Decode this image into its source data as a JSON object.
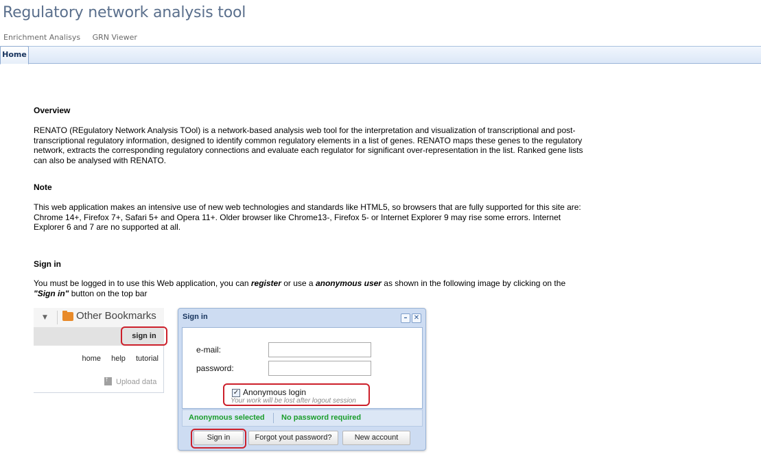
{
  "app": {
    "title": "Regulatory network analysis tool"
  },
  "nav": {
    "links": [
      "Enrichment Analisys",
      "GRN Viewer"
    ]
  },
  "tabs": {
    "home": "Home"
  },
  "overview": {
    "heading": "Overview",
    "text": "RENATO (REgulatory Network Analysis TOol) is a network-based analysis web tool for the interpretation and visualization of transcriptional and post-transcriptional regulatory information, designed to identify common regulatory elements in a list of genes. RENATO maps these genes to the regulatory network, extracts the corresponding regulatory connections and evaluate each regulator for significant over-representation in the list. Ranked gene lists can also be analysed with RENATO."
  },
  "note": {
    "heading": "Note",
    "text": "This web application makes an intensive use of new web technologies and standards like HTML5, so browsers that are fully supported for this site are: Chrome 14+, Firefox 7+, Safari 5+ and Opera 11+. Older browser like Chrome13-, Firefox 5- or Internet Explorer 9 may rise some errors. Internet Explorer 6 and 7 are no supported at all."
  },
  "signin_section": {
    "heading": "Sign in",
    "text_1": "You must be logged in to use this Web application, you can ",
    "register": "register",
    "text_2": " or use a ",
    "anonymous_user": "anonymous user",
    "text_3": " as shown in the following image by clicking on the",
    "signin_quote": "\"Sign in\"",
    "text_4": " button on the top bar"
  },
  "bookmarks_panel": {
    "folder_label": "Other Bookmarks",
    "signin_button": "sign in",
    "links": [
      "home",
      "help",
      "tutorial"
    ],
    "upload": "Upload data"
  },
  "dialog": {
    "title": "Sign in",
    "minimize_glyph": "–",
    "close_glyph": "✕",
    "email_label": "e-mail:",
    "password_label": "password:",
    "anonymous_label": "Anonymous login",
    "anonymous_hint": "Your work will be lost after logout session",
    "anonymous_checked": true,
    "status_left": "Anonymous selected",
    "status_right": "No password required",
    "buttons": {
      "signin": "Sign in",
      "forgot": "Forgot yout password?",
      "new_account": "New account"
    }
  },
  "colors": {
    "accent_red": "#cc1f2a",
    "status_green": "#1a9d2b",
    "title": "#5a6f8c"
  }
}
